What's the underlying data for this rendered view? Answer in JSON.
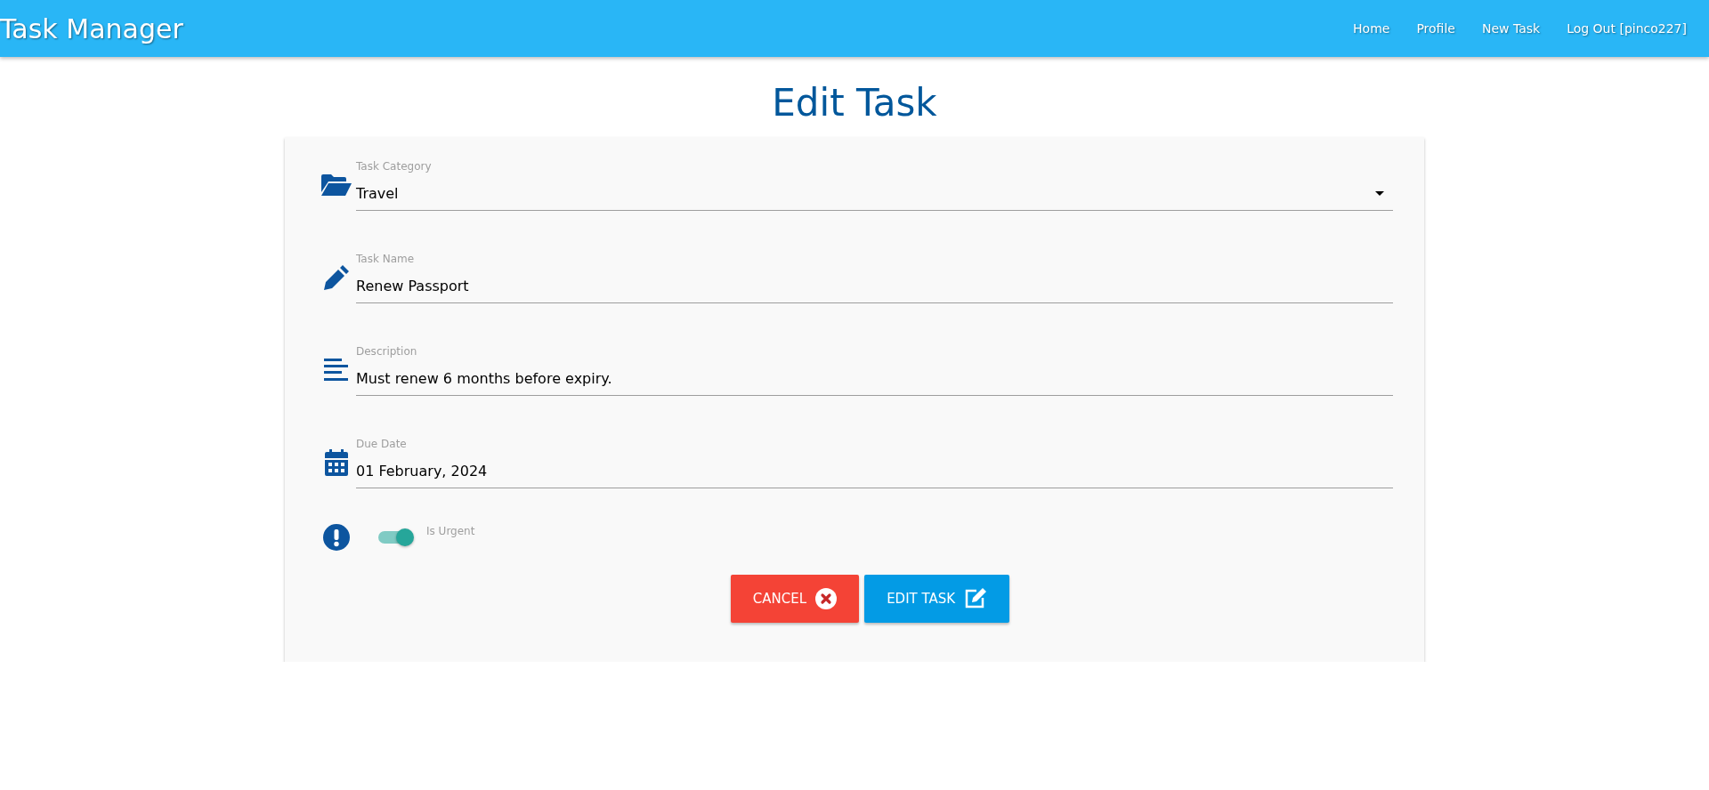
{
  "navbar": {
    "brand": "Task Manager",
    "links": [
      {
        "label": "Home"
      },
      {
        "label": "Profile"
      },
      {
        "label": "New Task"
      },
      {
        "label": "Log Out [pinco227]"
      }
    ]
  },
  "title": "Edit Task",
  "fields": [
    {
      "kind": "select",
      "label": "Task Category",
      "value": "Travel"
    },
    {
      "kind": "text",
      "label": "Task Name",
      "value": "Renew Passport"
    },
    {
      "kind": "text",
      "label": "Description",
      "value": "Must renew 6 months before expiry."
    },
    {
      "kind": "text",
      "label": "Due Date",
      "value": "01 February, 2024"
    }
  ],
  "urgent": {
    "label": "Is Urgent",
    "on": true
  },
  "buttons": [
    {
      "kind": "cancel",
      "label": "CANCEL"
    },
    {
      "kind": "submit",
      "label": "EDIT TASK"
    }
  ]
}
